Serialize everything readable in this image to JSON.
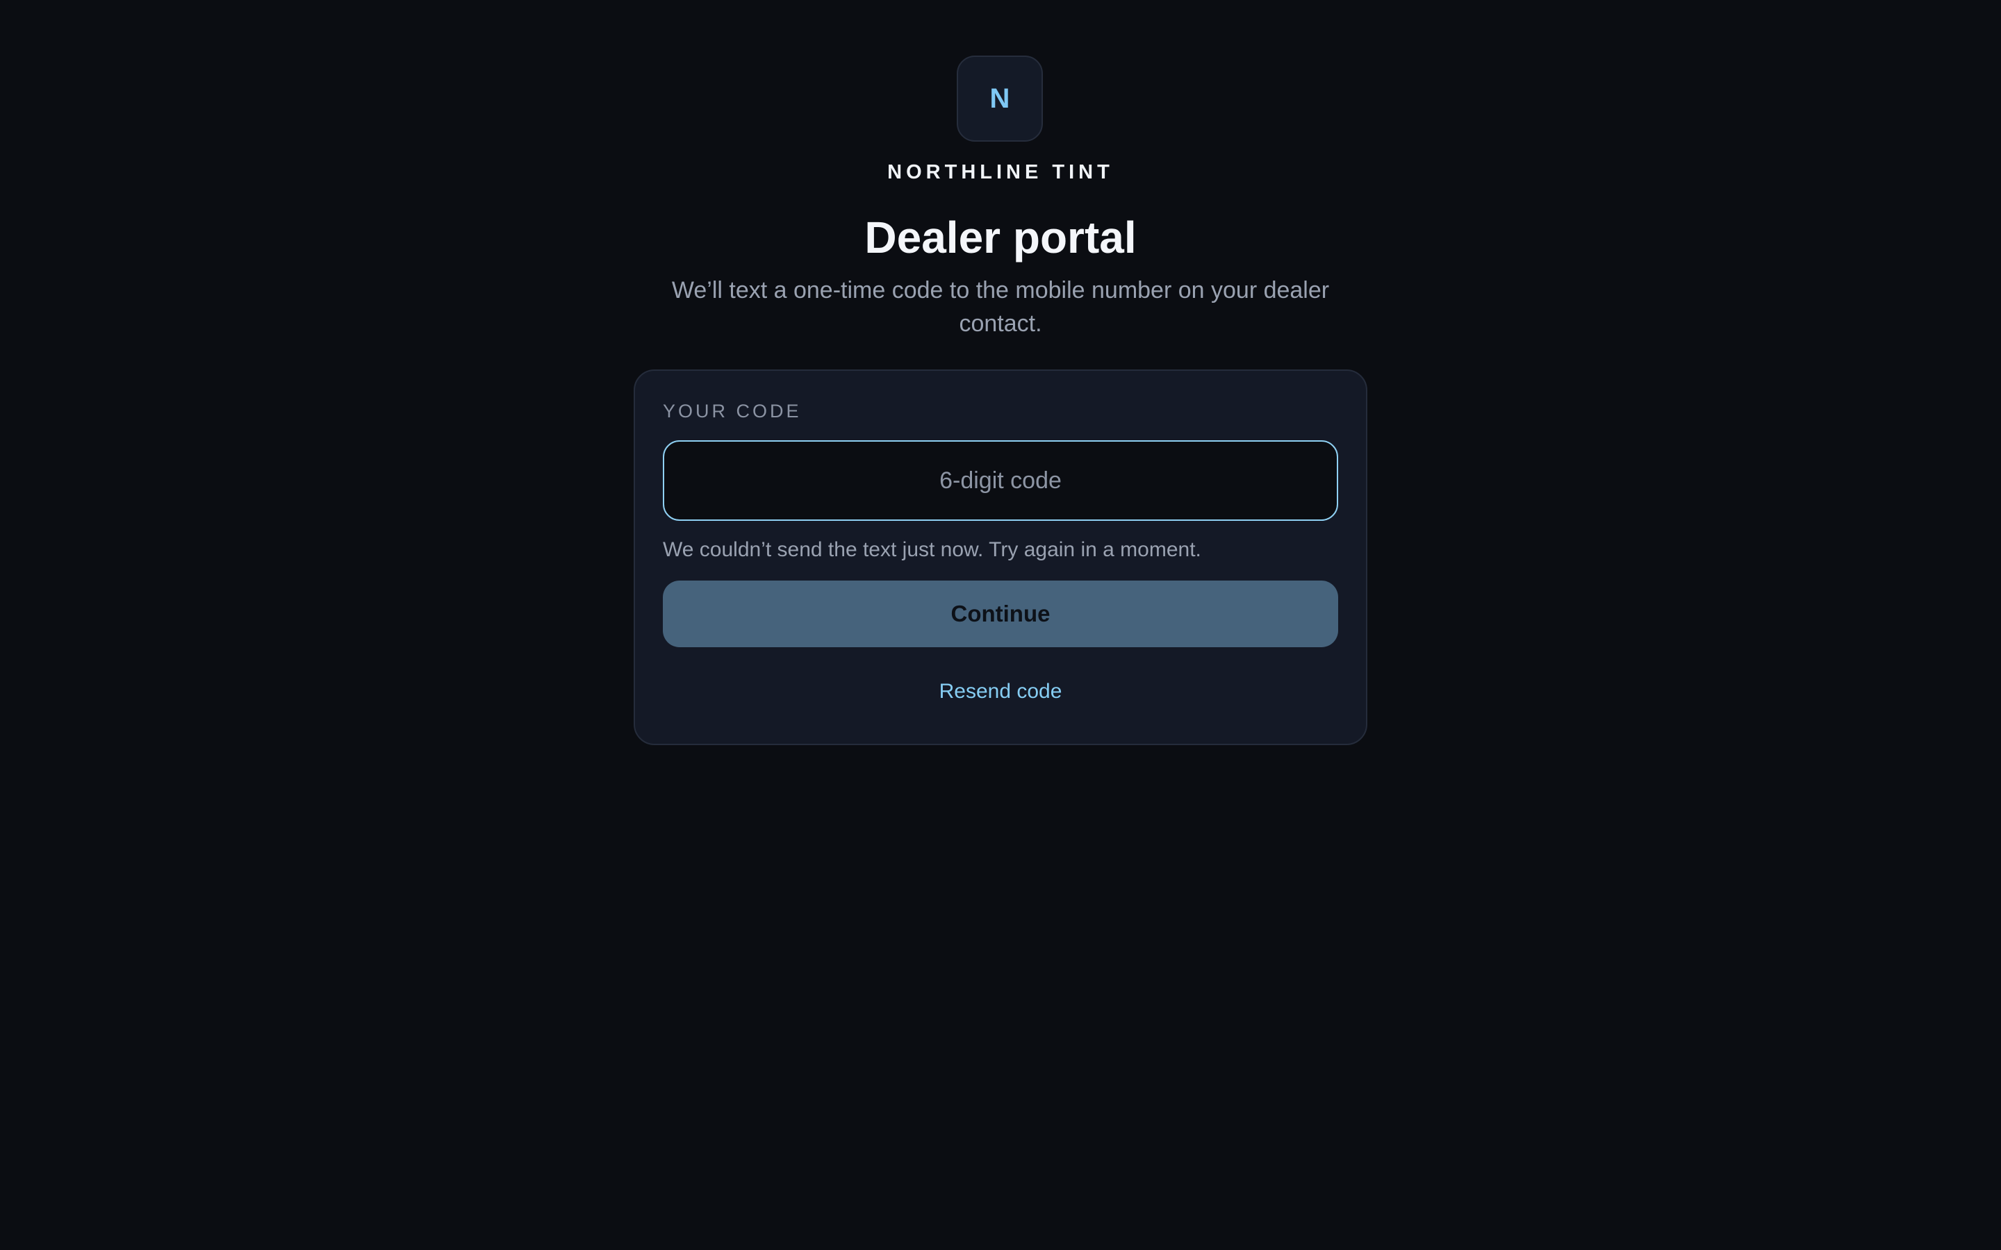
{
  "brand": {
    "logo_letter": "N",
    "name": "NORTHLINE TINT"
  },
  "header": {
    "title": "Dealer portal",
    "subtitle": "We’ll text a one-time code to the mobile number on your dealer contact."
  },
  "form": {
    "code_label": "YOUR CODE",
    "code_value": "",
    "code_placeholder": "6-digit code",
    "error_message": "We couldn’t send the text just now. Try again in a moment.",
    "continue_label": "Continue",
    "resend_label": "Resend code"
  },
  "colors": {
    "background": "#0b0d12",
    "card": "#141926",
    "accent": "#86cdf3",
    "button": "#46637c"
  }
}
